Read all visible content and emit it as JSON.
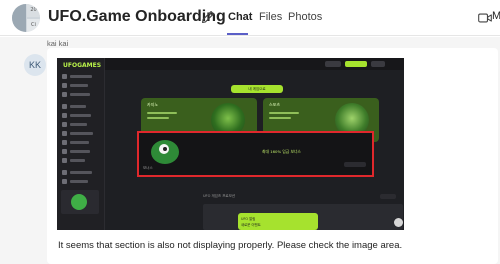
{
  "header": {
    "title": "UFO.Game Onboarding",
    "tabs": [
      {
        "label": "Chat",
        "active": true
      },
      {
        "label": "Files",
        "active": false
      },
      {
        "label": "Photos",
        "active": false
      }
    ],
    "group_avatar_labels": [
      "20",
      "Ci"
    ],
    "overflow_letter": "M",
    "accent_color": "#5b5fc7"
  },
  "message": {
    "sender": "kai kai",
    "avatar_initials": "KK",
    "text": "It seems that section is also not displaying properly. Please check the image area."
  },
  "screenshot": {
    "logo": "UFOGAMES",
    "top_button_label": "내 게임으로",
    "panels": [
      {
        "label": "카지노",
        "color": "#3a5f1d"
      },
      {
        "label": "스포츠",
        "color": "#3a5f1d"
      }
    ],
    "highlight_text": "최대 160% 입금 보너스",
    "highlight_small_label": "보너스",
    "bottom_title": "UFO 게임즈 프로모션",
    "notify_title": "UFO 알림",
    "notify_text": "새로운 이벤트",
    "highlight_border_color": "#e0282c",
    "accent_green": "#a6e22e"
  }
}
